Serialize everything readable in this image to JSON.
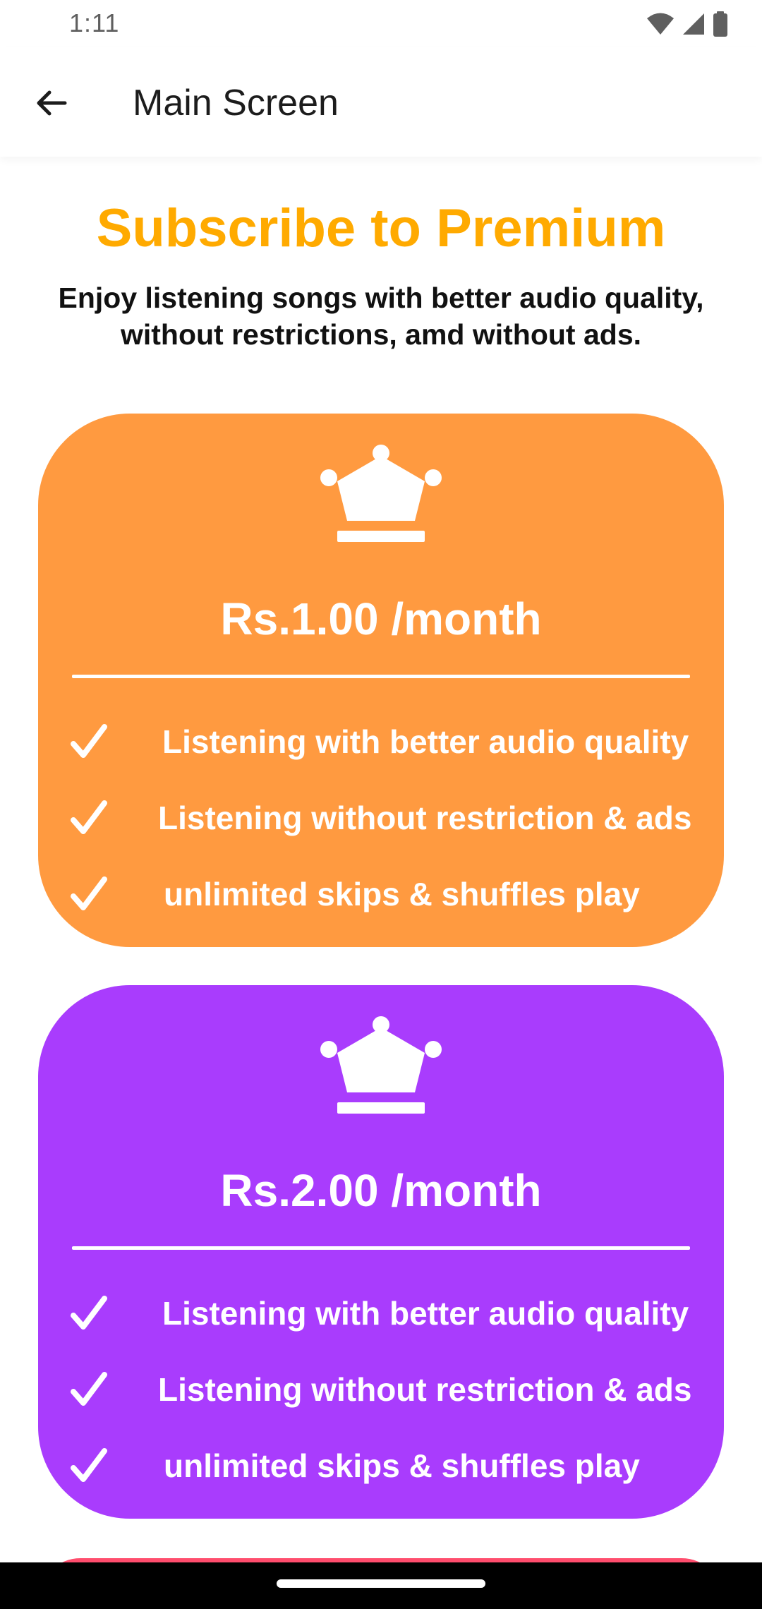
{
  "status_bar": {
    "time": "1:11",
    "icons": [
      "wifi-icon",
      "signal-icon",
      "battery-icon"
    ]
  },
  "app_bar": {
    "title": "Main Screen",
    "back_icon": "arrow-back-icon"
  },
  "header": {
    "headline": "Subscribe to Premium",
    "subtitle": "Enjoy listening songs with better audio quality, without restrictions, amd without ads."
  },
  "plans": [
    {
      "color": "#ff9a40",
      "icon": "crown-icon",
      "price": "Rs.1.00 /month",
      "features": [
        "Listening with better audio quality",
        "Listening without restriction & ads",
        "unlimited skips & shuffles play"
      ]
    },
    {
      "color": "#a93cfd",
      "icon": "crown-icon",
      "price": "Rs.2.00 /month",
      "features": [
        "Listening with better audio quality",
        "Listening without restriction & ads",
        "unlimited skips & shuffles play"
      ]
    },
    {
      "color": "#ff4d6d"
    }
  ],
  "colors": {
    "headline": "#ffaa00",
    "text": "#111111",
    "nav_bar": "#000000"
  }
}
